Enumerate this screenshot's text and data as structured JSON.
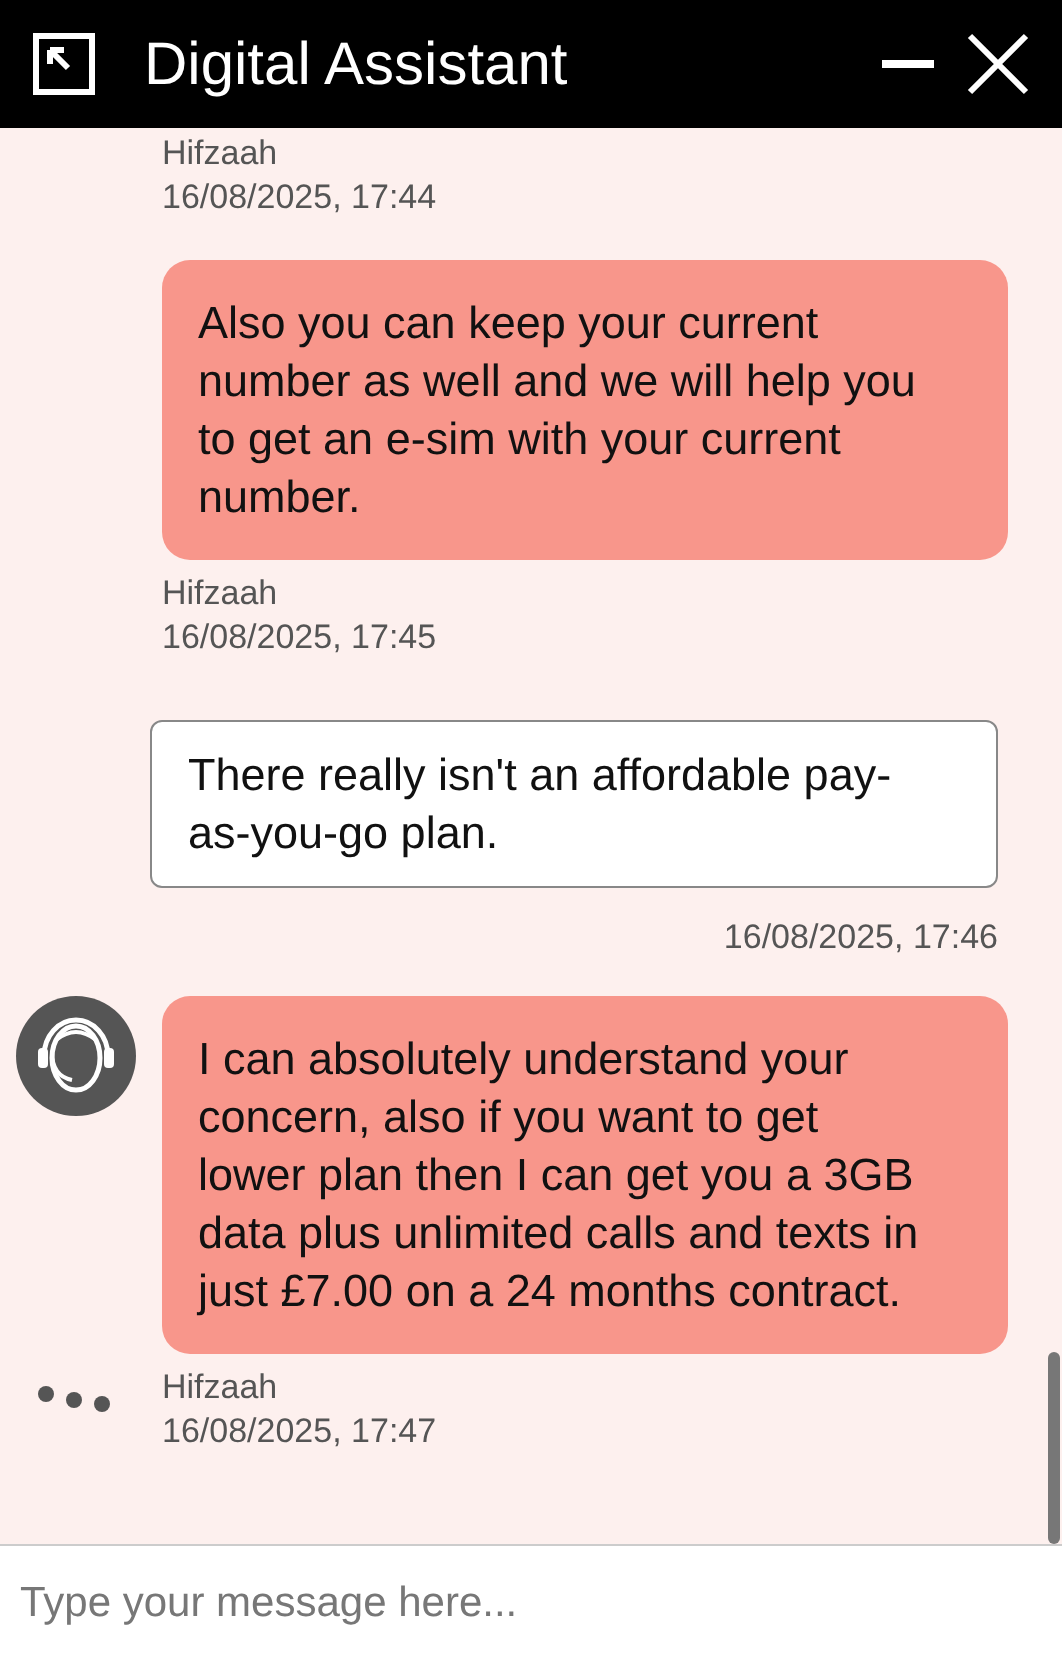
{
  "window": {
    "title": "Digital Assistant"
  },
  "messages": [
    {
      "kind": "meta",
      "sender": "Hifzaah",
      "time": "16/08/2025, 17:44",
      "typing": false
    },
    {
      "kind": "agent",
      "text": "Also you can keep your current number as well and we will help you to get an e-sim with your current number.",
      "avatar": false
    },
    {
      "kind": "meta",
      "sender": "Hifzaah",
      "time": "16/08/2025, 17:45",
      "typing": false
    },
    {
      "kind": "user",
      "text": "There really isn't an affordable pay-as-you-go plan.",
      "time": "16/08/2025, 17:46"
    },
    {
      "kind": "agent",
      "text": "I can absolutely understand your concern, also if you want to get lower plan then I can get you a 3GB data plus unlimited calls and texts in just £7.00 on a 24 months contract.",
      "avatar": true
    },
    {
      "kind": "meta",
      "sender": "Hifzaah",
      "time": "16/08/2025, 17:47",
      "typing": true
    }
  ],
  "composer": {
    "placeholder": "Type your message here..."
  }
}
